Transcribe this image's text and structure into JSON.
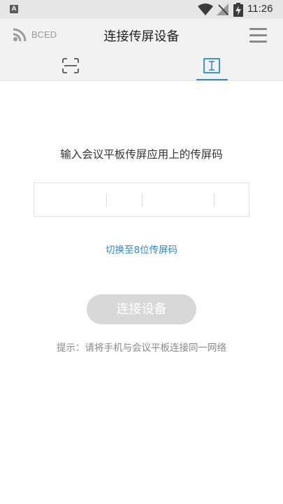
{
  "status_bar": {
    "notification_letter": "A",
    "time": "11:26"
  },
  "header": {
    "device_name": "BCED",
    "title": "连接传屏设备",
    "icons": [
      "rss-icon",
      "menu-icon"
    ]
  },
  "tabs": [
    {
      "name": "scan",
      "icon": "scan-frame-icon",
      "active": false
    },
    {
      "name": "code",
      "icon": "text-cursor-icon",
      "active": true
    }
  ],
  "main": {
    "instruction": "输入会议平板传屏应用上的传屏码",
    "code_value": "",
    "switch_link": "切换至8位传屏码",
    "connect_button": "连接设备",
    "hint": "提示：请将手机与会议平板连接同一网络"
  },
  "colors": {
    "accent": "#2a8ad8",
    "header_bg": "#f2f2f2",
    "status_bar_bg": "#e6e6e6",
    "button_disabled_bg": "#d8d8d8"
  }
}
